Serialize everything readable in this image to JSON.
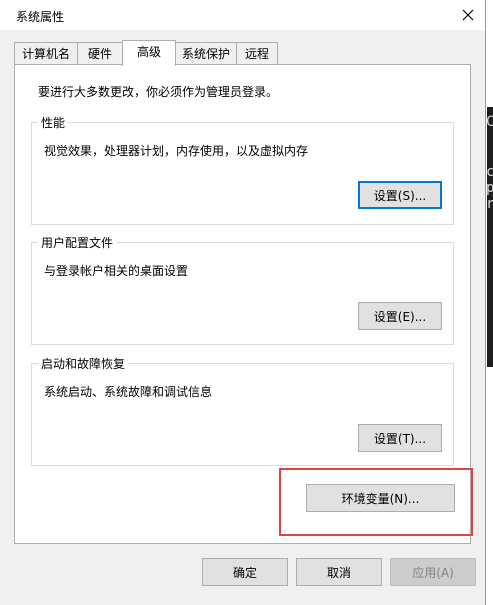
{
  "window": {
    "title": "系统属性"
  },
  "tabs": [
    {
      "label": "计算机名"
    },
    {
      "label": "硬件"
    },
    {
      "label": "高级"
    },
    {
      "label": "系统保护"
    },
    {
      "label": "远程"
    }
  ],
  "intro_text": "要进行大多数更改，你必须作为管理员登录。",
  "performance": {
    "title": "性能",
    "description": "视觉效果，处理器计划，内存使用，以及虚拟内存",
    "button": "设置(S)..."
  },
  "user_profiles": {
    "title": "用户配置文件",
    "description": "与登录帐户相关的桌面设置",
    "button": "设置(E)..."
  },
  "startup_recovery": {
    "title": "启动和故障恢复",
    "description": "系统启动、系统故障和调试信息",
    "button": "设置(T)..."
  },
  "env_button": "环境变量(N)...",
  "footer": {
    "ok": "确定",
    "cancel": "取消",
    "apply": "应用(A)"
  },
  "background_chars": [
    "C",
    "c",
    "p",
    "r",
    "C"
  ],
  "colors": {
    "accent": "#0078d7",
    "highlight_box": "#e04343"
  }
}
